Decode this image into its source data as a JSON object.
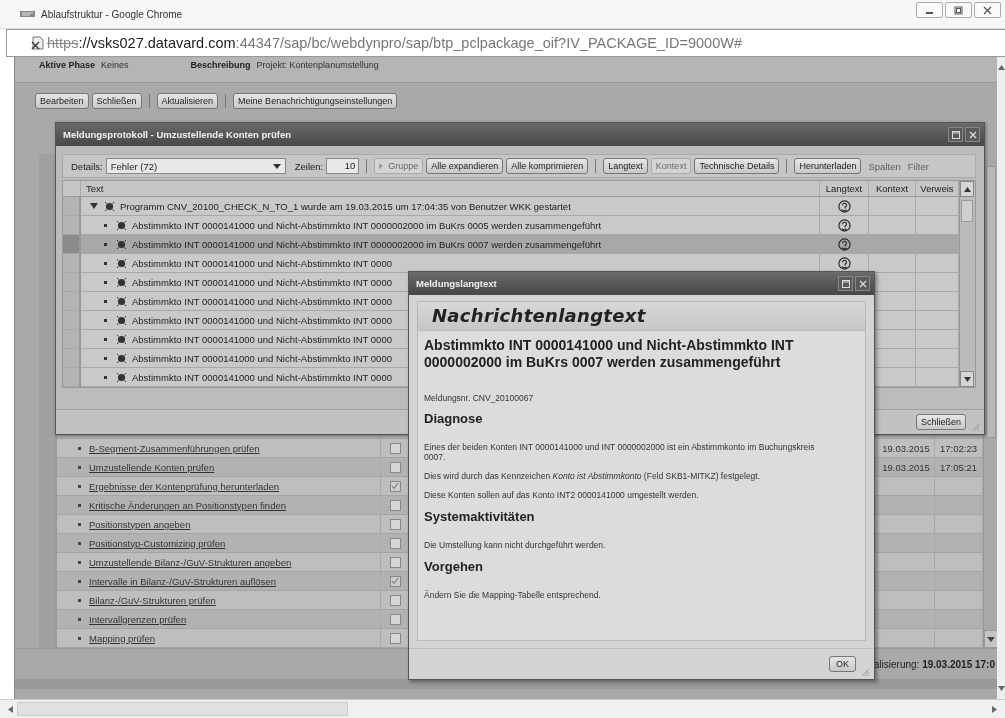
{
  "browser": {
    "title": "Ablaufstruktur - Google Chrome",
    "url_parts": [
      "https",
      "://vsks027.datavard.com",
      ":44347/sap/bc/webdynpro/sap/btp_pclpackage_oif?IV_PACKAGE_ID=9000W#"
    ]
  },
  "page": {
    "info": [
      {
        "label": "Aktive Phase",
        "value": "Keines"
      },
      {
        "label": "Beschreibung",
        "value": "Projekt: Kontenplanumstellung"
      }
    ],
    "toolbar_groups": [
      [
        "Bearbeiten",
        "Schließen"
      ],
      [
        "Aktualisieren"
      ],
      [
        "Meine Benachrichtigungseinstellungen"
      ]
    ],
    "steps": [
      {
        "label": "B-Segment-Zusammenführungen prüfen",
        "checked": false,
        "date": "19.03.2015",
        "time": "17:02:23"
      },
      {
        "label": "Umzustellende Konten prüfen",
        "checked": false,
        "date": "19.03.2015",
        "time": "17:05:21"
      },
      {
        "label": "Ergebnisse der Kontenprüfung herunterladen",
        "checked": true
      },
      {
        "label": "Kritische Änderungen an Positionstypen finden",
        "checked": false
      },
      {
        "label": "Positionstypen angeben",
        "checked": false
      },
      {
        "label": "Positionstyp-Customizing prüfen",
        "checked": false
      },
      {
        "label": "Umzustellende Bilanz-/GuV-Strukturen angeben",
        "checked": false
      },
      {
        "label": "Intervalle in Bilanz-/GuV-Strukturen auflösen",
        "checked": true
      },
      {
        "label": "Bilanz-/GuV-Strukturen prüfen",
        "checked": false
      },
      {
        "label": "Intervallgrenzen prüfen",
        "checked": false
      },
      {
        "label": "Mapping prüfen",
        "checked": false
      }
    ],
    "status": "alisierung: **19.03.2015 17:0**"
  },
  "log_window": {
    "title": "Meldungsprotokoll - Umzustellende Konten prüfen",
    "details_label": "Details:",
    "details_value": "Fehler (72)",
    "rows_label": "Zeilen:",
    "rows_value": "10",
    "button_groups": [
      [
        {
          "label": "Gruppe",
          "kind": "menu",
          "disabled": true
        },
        {
          "label": "Alle expandieren",
          "kind": "plain",
          "disabled": false
        },
        {
          "label": "Alle komprimieren",
          "kind": "plain",
          "disabled": false
        }
      ],
      [
        {
          "label": "Langtext",
          "kind": "plain",
          "disabled": false
        },
        {
          "label": "Kontext",
          "kind": "plain",
          "disabled": true
        },
        {
          "label": "Technische Details",
          "kind": "plain",
          "disabled": false
        }
      ],
      [
        {
          "label": "Herunterladen",
          "kind": "plain",
          "disabled": false
        }
      ]
    ],
    "links": [
      {
        "label": "Spalten",
        "disabled": true
      },
      {
        "label": "Filter",
        "disabled": true
      }
    ],
    "columns": [
      "Text",
      "Langtext",
      "Kontext",
      "Verweis"
    ],
    "rows": [
      {
        "text": "Programm CNV_20100_CHECK_N_TO_1 wurde am 19.03.2015 um 17:04:35 von Benutzer WKK gestartet",
        "expanded": true,
        "selected": false,
        "longtext": true,
        "children": [
          {
            "text": "Abstimmkto INT 0000141000 und Nicht-Abstimmkto INT 0000002000 im BuKrs 0005 werden zusammengeführt",
            "selected": false,
            "longtext": true
          },
          {
            "text": "Abstimmkto INT 0000141000 und Nicht-Abstimmkto INT 0000002000 im BuKrs 0007 werden zusammengeführt",
            "selected": true,
            "longtext": true
          },
          {
            "text": "Abstimmkto INT 0000141000 und Nicht-Abstimmkto INT 0000",
            "selected": false,
            "longtext": true
          },
          {
            "text": "Abstimmkto INT 0000141000 und Nicht-Abstimmkto INT 0000",
            "selected": false,
            "longtext": false
          },
          {
            "text": "Abstimmkto INT 0000141000 und Nicht-Abstimmkto INT 0000",
            "selected": false,
            "longtext": false
          },
          {
            "text": "Abstimmkto INT 0000141000 und Nicht-Abstimmkto INT 0000",
            "selected": false,
            "longtext": false
          },
          {
            "text": "Abstimmkto INT 0000141000 und Nicht-Abstimmkto INT 0000",
            "selected": false,
            "longtext": false
          },
          {
            "text": "Abstimmkto INT 0000141000 und Nicht-Abstimmkto INT 0000",
            "selected": false,
            "longtext": false
          },
          {
            "text": "Abstimmkto INT 0000141000 und Nicht-Abstimmkto INT 0000",
            "selected": false,
            "longtext": false
          }
        ]
      }
    ],
    "close_button": "Schließen"
  },
  "longtext_dialog": {
    "title": "Meldungslangtext",
    "header": "Nachrichtenlangtext",
    "heading": "Abstimmkto INT 0000141000 und Nicht-Abstimmkto INT 0000002000 im BuKrs 0007 werden zusammengeführt",
    "message_number": "Meldungsnr. CNV_20100067",
    "sections": [
      {
        "heading": "Diagnose",
        "paragraphs": [
          "Eines der beiden Konten INT 0000141000 und INT 0000002000 ist ein Abstimmkonto im Buchungskreis 0007.",
          "Dies wird durch das Kennzeichen *Konto ist Abstimmkonto* (Feld SKB1-MITKZ) festgelegt.",
          "Diese Konten sollen auf das Konto INT2 0000141000 umgestellt werden."
        ]
      },
      {
        "heading": "Systemaktivitäten",
        "paragraphs": [
          "Die Umstellung kann nicht durchgeführt werden."
        ]
      },
      {
        "heading": "Vorgehen",
        "paragraphs": [
          "Ändern Sie die Mapping-Tabelle entsprechend."
        ]
      }
    ],
    "ok_button": "OK"
  }
}
